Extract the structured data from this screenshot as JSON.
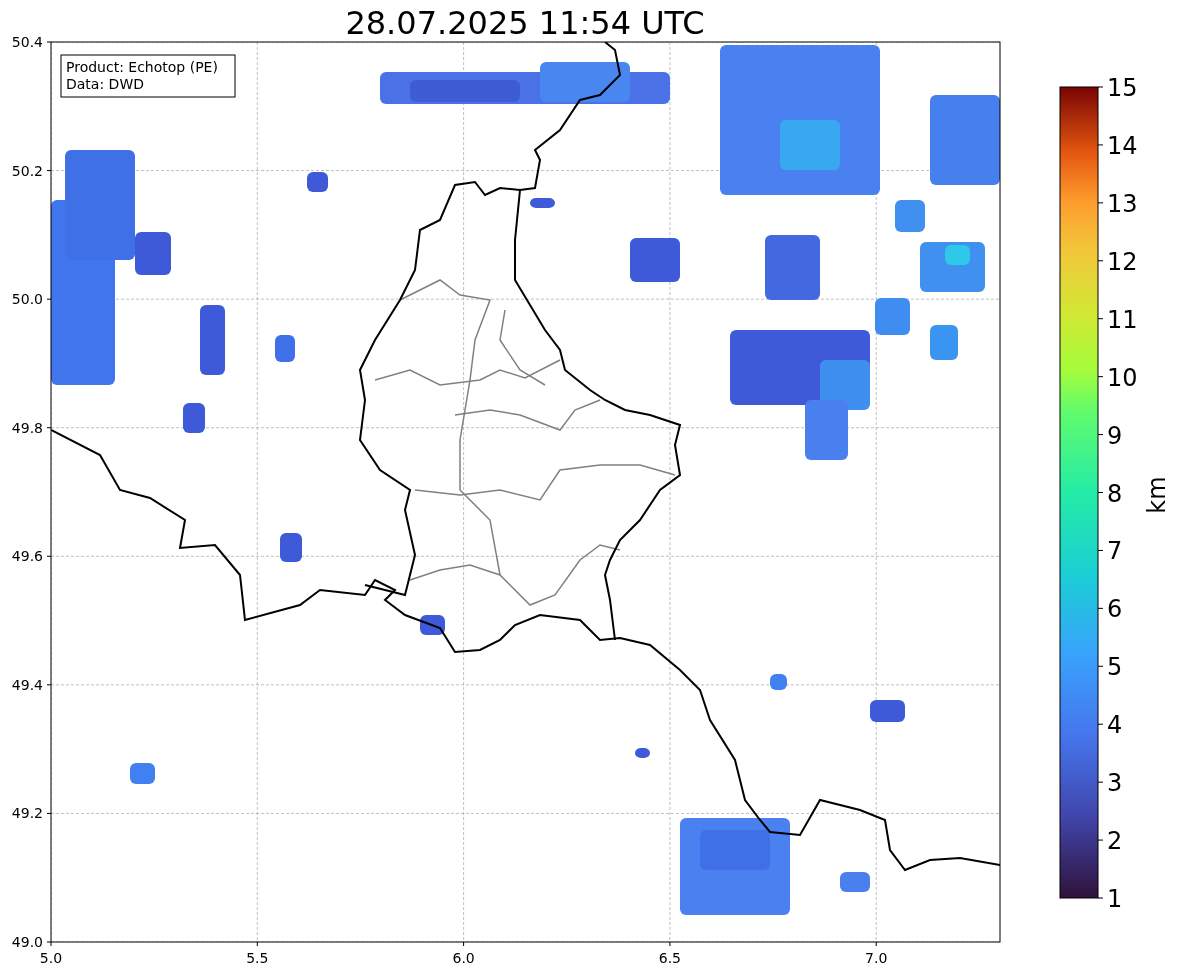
{
  "title": "28.07.2025 11:54 UTC",
  "legend": [
    "Product: Echotop (PE)",
    "Data: DWD"
  ],
  "xticks": [
    "5.0",
    "5.5",
    "6.0",
    "6.5",
    "7.0"
  ],
  "yticks": [
    "50.4",
    "50.2",
    "50.0",
    "49.8",
    "49.6",
    "49.4",
    "49.2",
    "49.0"
  ],
  "colorbar": {
    "label": "km",
    "ticks": [
      "15",
      "14",
      "13",
      "12",
      "11",
      "10",
      "9",
      "8",
      "7",
      "6",
      "5",
      "4",
      "3",
      "2",
      "1"
    ]
  }
}
